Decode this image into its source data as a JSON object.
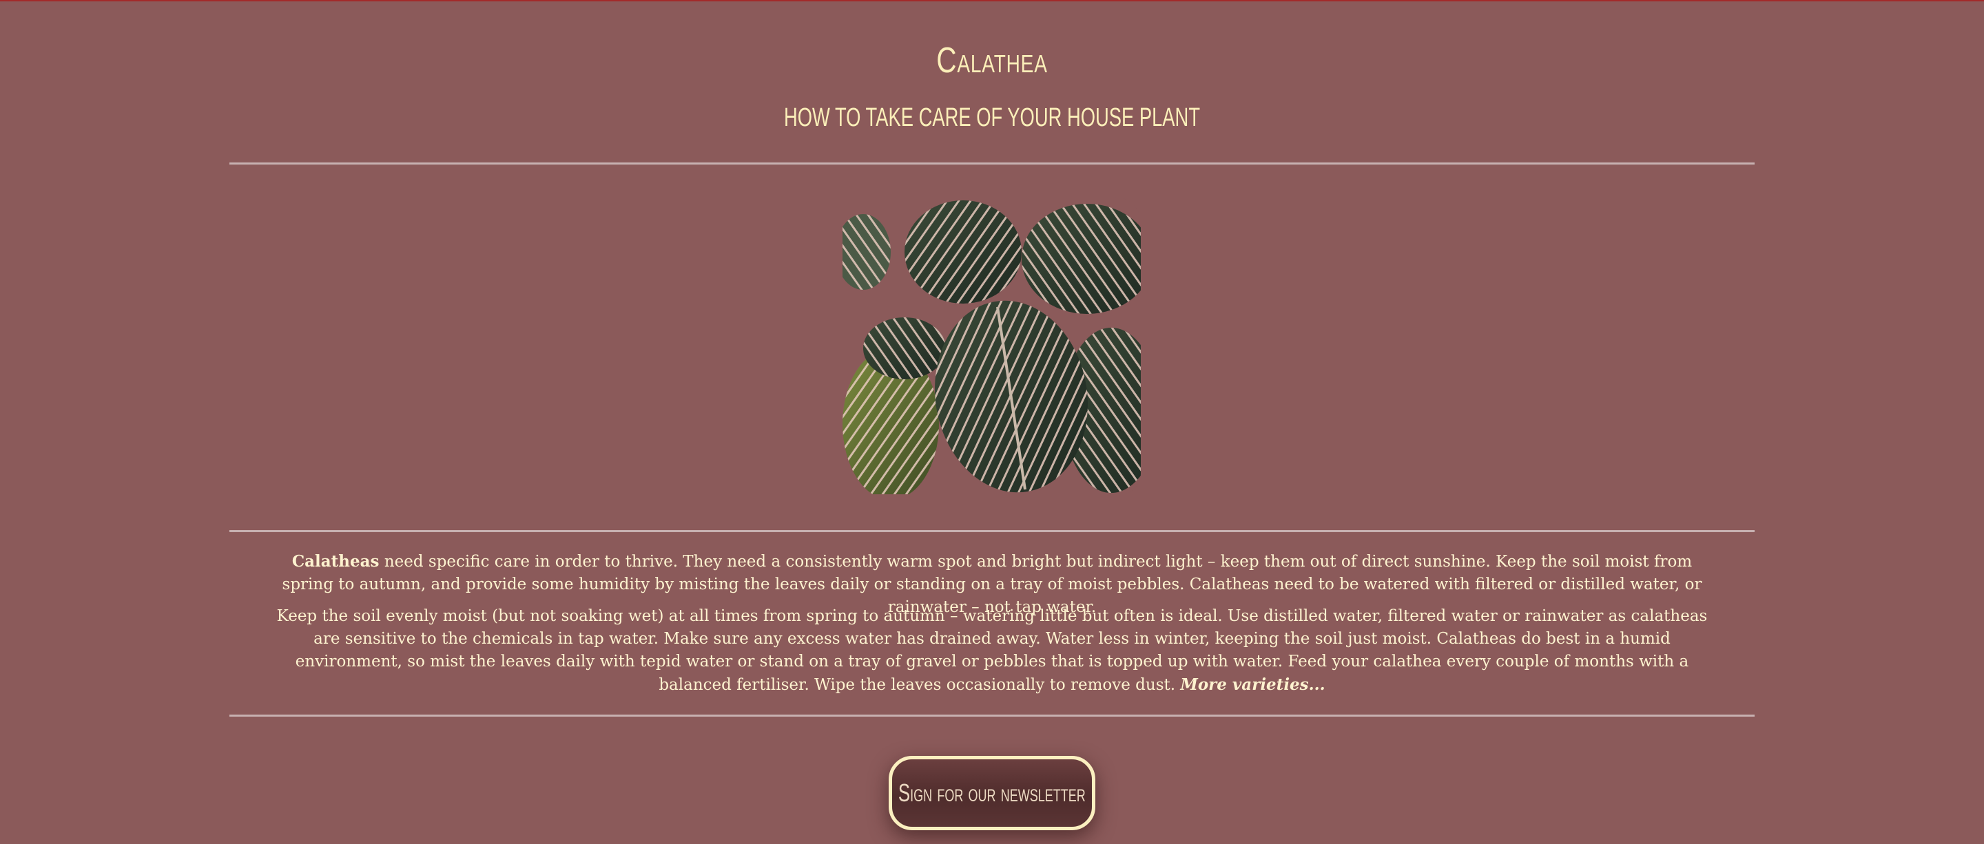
{
  "header": {
    "title": "Calathea",
    "subtitle": "How to take care of your house plant"
  },
  "image": {
    "subject": "calathea-leaves-photo"
  },
  "content": {
    "p1_lead": "Calatheas",
    "p1_text": " need specific care in order to thrive. They need a consistently warm spot and bright but indirect light – keep them out of direct sunshine. Keep the soil moist from spring to autumn, and provide some humidity by misting the leaves daily or standing on a tray of moist pebbles. Calatheas need to be watered with filtered or distilled water, or rainwater – not tap water.",
    "p2_text": "Keep the soil evenly moist (but not soaking wet) at all times from spring to autumn – watering little but often is ideal. Use distilled water, filtered water or rainwater as calatheas are sensitive to the chemicals in tap water. Make sure any excess water has drained away. Water less in winter, keeping the soil just moist. Calatheas do best in a humid environment, so mist the leaves daily with tepid water or stand on a tray of gravel or pebbles that is topped up with water. Feed your calathea every couple of months with a balanced fertiliser. Wipe the leaves occasionally to remove dust. ",
    "more_link": "More varieties..."
  },
  "newsletter": {
    "label": "Sign for our newsletter"
  },
  "colors": {
    "background": "#8b5a5a",
    "text": "#fdf2cf",
    "rule": "#c7b1b1",
    "top_border": "#a32a2a"
  }
}
